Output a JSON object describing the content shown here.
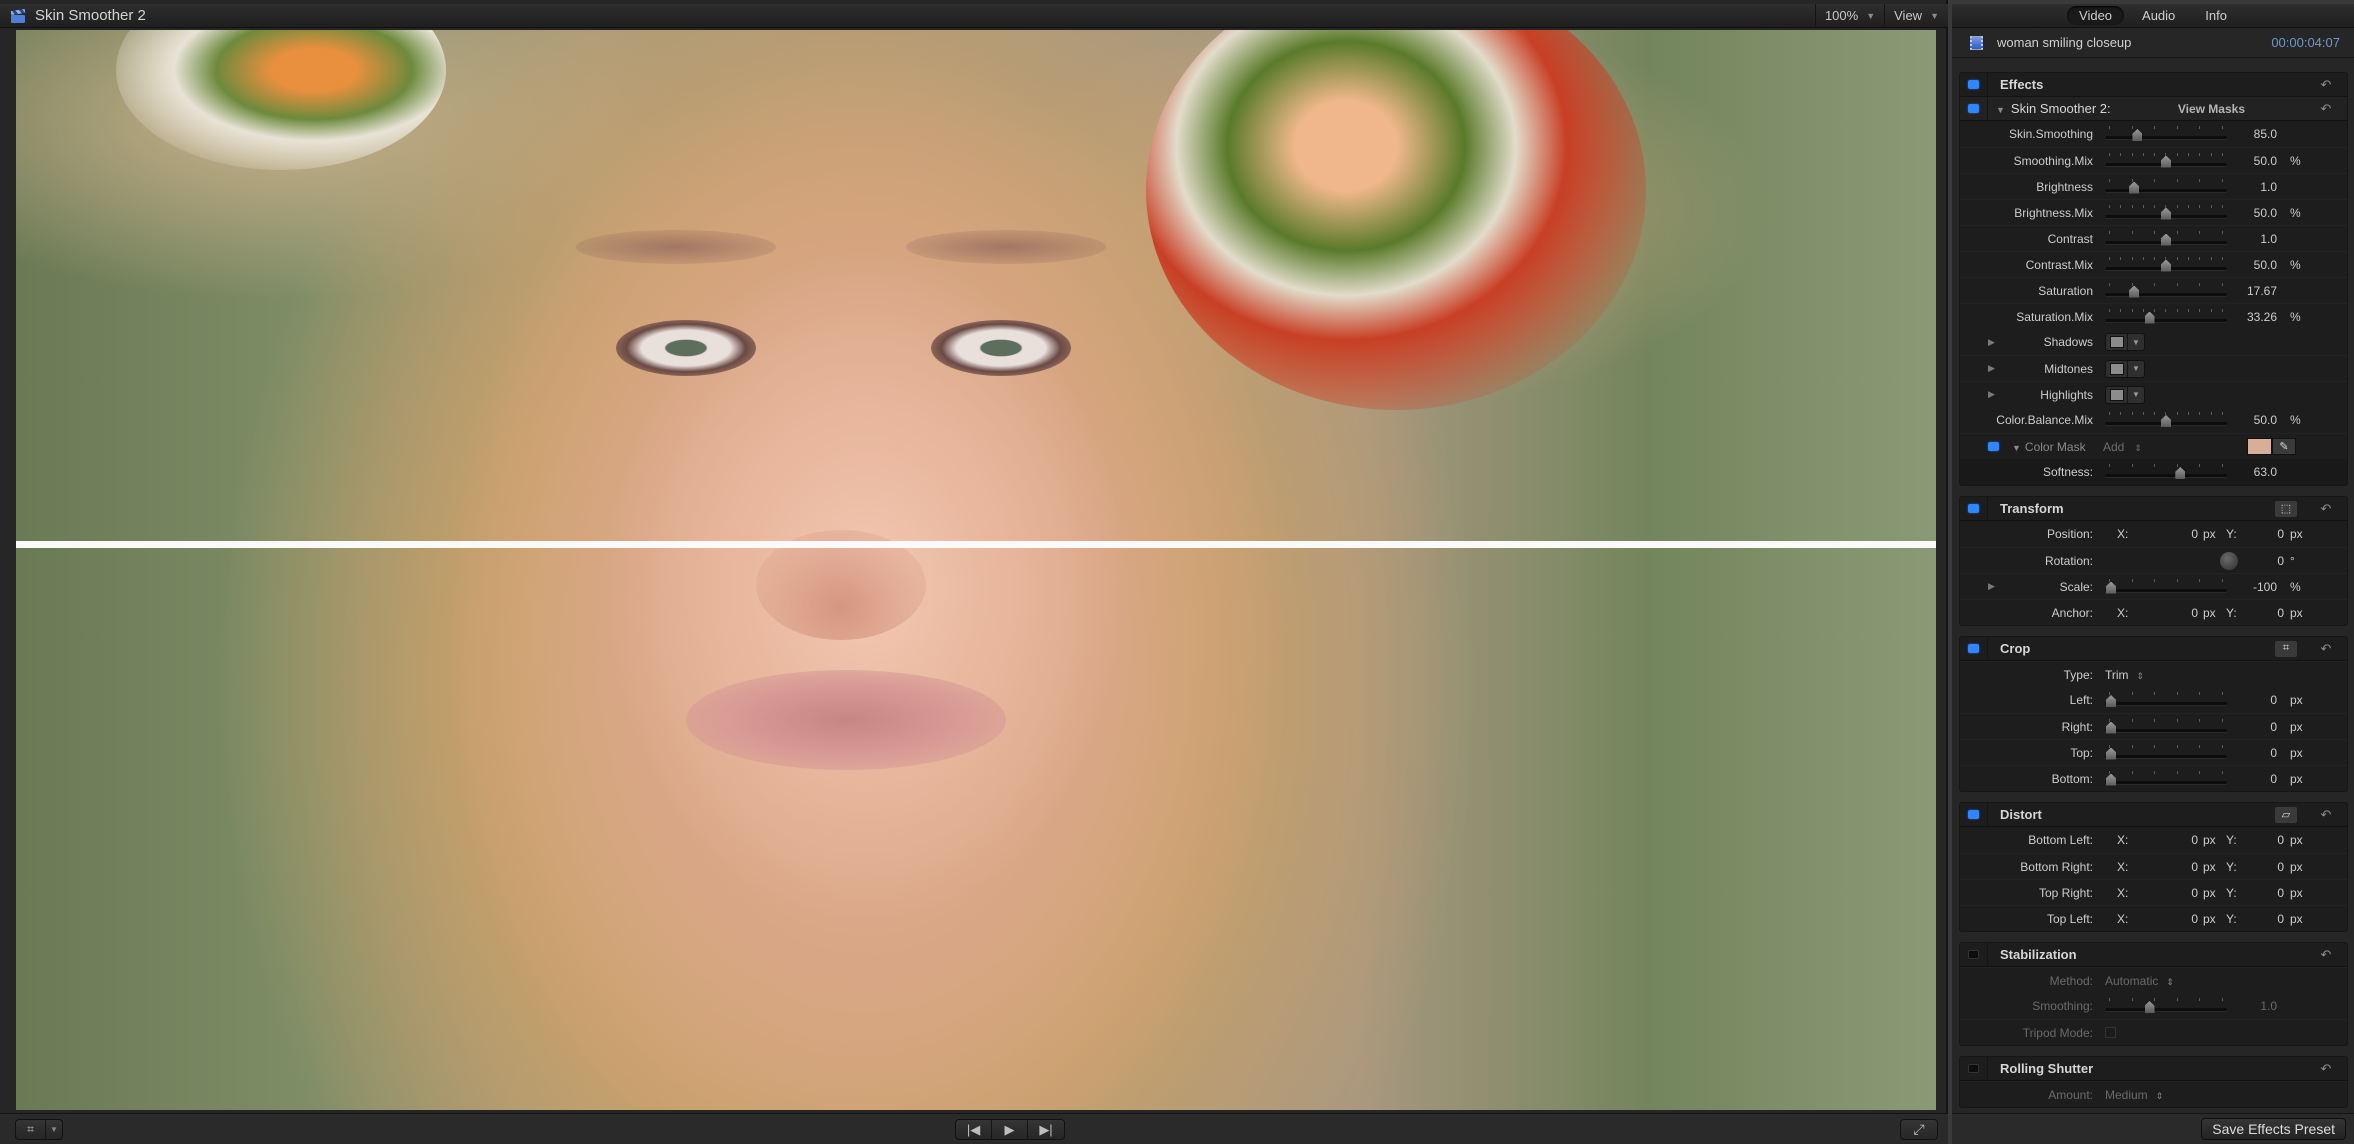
{
  "viewer": {
    "title": "Skin Smoother 2",
    "zoom_label": "100%",
    "view_label": "View",
    "transport": {
      "prev_icon": "◀",
      "play_icon": "▶",
      "next_icon": "▶"
    }
  },
  "inspector": {
    "tabs": [
      {
        "label": "Video",
        "active": true
      },
      {
        "label": "Audio",
        "active": false
      },
      {
        "label": "Info",
        "active": false
      }
    ],
    "clip_name": "woman smiling closeup",
    "timecode": "00:00:04:07",
    "effects": {
      "title": "Effects",
      "enabled": true,
      "skin_smoother": {
        "title": "Skin Smoother 2:",
        "view_masks_label": "View Masks",
        "enabled": true,
        "params": [
          {
            "label": "Skin.Smoothing",
            "value": "85.0",
            "unit": "",
            "slider_fraction": 0.24
          },
          {
            "label": "Smoothing.Mix",
            "value": "50.0",
            "unit": "%",
            "slider_fraction": 0.5
          },
          {
            "label": "Brightness",
            "value": "1.0",
            "unit": "",
            "slider_fraction": 0.21
          },
          {
            "label": "Brightness.Mix",
            "value": "50.0",
            "unit": "%",
            "slider_fraction": 0.5
          },
          {
            "label": "Contrast",
            "value": "1.0",
            "unit": "",
            "slider_fraction": 0.5
          },
          {
            "label": "Contrast.Mix",
            "value": "50.0",
            "unit": "%",
            "slider_fraction": 0.5
          },
          {
            "label": "Saturation",
            "value": "17.67",
            "unit": "",
            "slider_fraction": 0.21
          },
          {
            "label": "Saturation.Mix",
            "value": "33.26",
            "unit": "%",
            "slider_fraction": 0.35
          }
        ],
        "color_wheels": [
          {
            "label": "Shadows"
          },
          {
            "label": "Midtones"
          },
          {
            "label": "Highlights"
          }
        ],
        "color_balance_mix": {
          "label": "Color.Balance.Mix",
          "value": "50.0",
          "unit": "%",
          "slider_fraction": 0.5
        },
        "color_mask": {
          "label": "Color Mask",
          "mode": "Add",
          "enabled": true,
          "color": "#d8ad99"
        },
        "softness": {
          "label": "Softness:",
          "value": "63.0",
          "slider_fraction": 0.63
        }
      }
    },
    "transform": {
      "title": "Transform",
      "enabled": true,
      "position": {
        "label": "Position:",
        "x": "0",
        "y": "0",
        "unit": "px"
      },
      "rotation": {
        "label": "Rotation:",
        "value": "0",
        "unit": "°"
      },
      "scale": {
        "label": "Scale:",
        "value": "-100",
        "unit": "%",
        "slider_fraction": 0.0
      },
      "anchor": {
        "label": "Anchor:",
        "x": "0",
        "y": "0",
        "unit": "px"
      }
    },
    "crop": {
      "title": "Crop",
      "enabled": true,
      "type": {
        "label": "Type:",
        "value": "Trim"
      },
      "params": [
        {
          "label": "Left:",
          "value": "0",
          "unit": "px",
          "slider_fraction": 0.0
        },
        {
          "label": "Right:",
          "value": "0",
          "unit": "px",
          "slider_fraction": 0.0
        },
        {
          "label": "Top:",
          "value": "0",
          "unit": "px",
          "slider_fraction": 0.0
        },
        {
          "label": "Bottom:",
          "value": "0",
          "unit": "px",
          "slider_fraction": 0.0
        }
      ]
    },
    "distort": {
      "title": "Distort",
      "enabled": true,
      "params": [
        {
          "label": "Bottom Left:",
          "x": "0",
          "y": "0",
          "unit": "px"
        },
        {
          "label": "Bottom Right:",
          "x": "0",
          "y": "0",
          "unit": "px"
        },
        {
          "label": "Top Right:",
          "x": "0",
          "y": "0",
          "unit": "px"
        },
        {
          "label": "Top Left:",
          "x": "0",
          "y": "0",
          "unit": "px"
        }
      ]
    },
    "stabilization": {
      "title": "Stabilization",
      "enabled": false,
      "method": {
        "label": "Method:",
        "value": "Automatic"
      },
      "smoothing": {
        "label": "Smoothing:",
        "value": "1.0",
        "slider_fraction": 0.35
      },
      "tripod_mode": {
        "label": "Tripod Mode:",
        "checked": false
      }
    },
    "rolling_shutter": {
      "title": "Rolling Shutter",
      "enabled": false,
      "amount": {
        "label": "Amount:",
        "value": "Medium"
      }
    },
    "save_preset_label": "Save Effects Preset",
    "xy_labels": {
      "x": "X:",
      "y": "Y:"
    }
  },
  "colors": {
    "accent_blue": "#2f86ff",
    "timecode_blue": "#6f95cf",
    "panel_bg": "#1d1d1d"
  }
}
